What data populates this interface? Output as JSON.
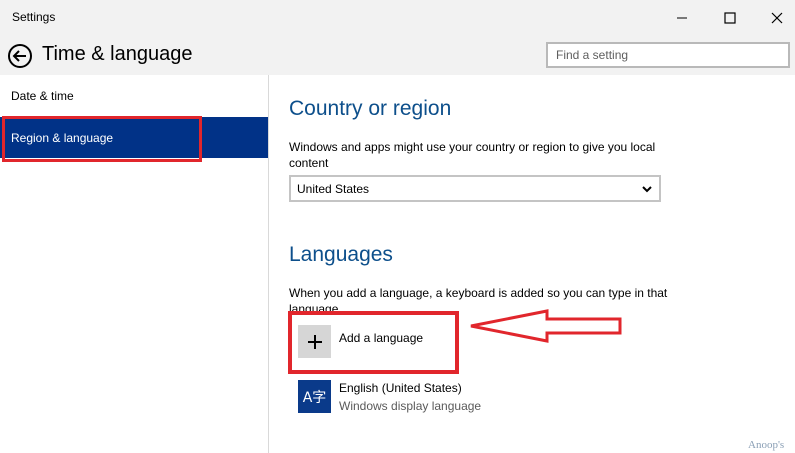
{
  "window": {
    "title": "Settings",
    "minimize_icon": "minimize-icon",
    "maximize_icon": "maximize-icon",
    "close_icon": "close-icon"
  },
  "header": {
    "back_icon": "back-arrow-icon",
    "title": "Time & language",
    "search_placeholder": "Find a setting"
  },
  "sidebar": {
    "items": [
      {
        "label": "Date & time",
        "selected": false
      },
      {
        "label": "Region & language",
        "selected": true
      }
    ]
  },
  "country": {
    "heading": "Country or region",
    "description": "Windows and apps might use your country or region to give you local content",
    "selected": "United States"
  },
  "languages": {
    "heading": "Languages",
    "description": "When you add a language, a keyboard is added so you can type in that language",
    "add_label": "Add a language",
    "list": [
      {
        "icon_text": "A字",
        "name": "English (United States)",
        "subtitle": "Windows display language"
      }
    ]
  },
  "watermark": "Anoop's",
  "colors": {
    "accent": "#013287",
    "heading": "#0d4f8b",
    "highlight": "#e1262c"
  }
}
